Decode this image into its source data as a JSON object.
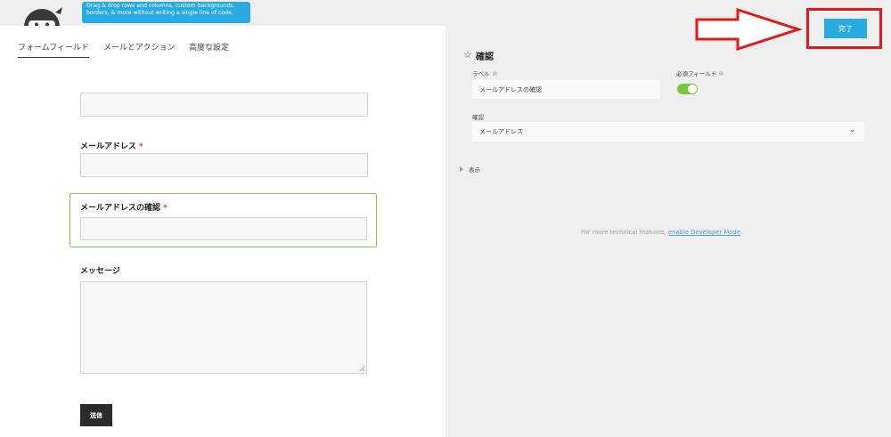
{
  "promo": {
    "lines": [
      "Drag & drop rows and columns, custom backgrounds,",
      "borders, & more without writing a single line of code."
    ]
  },
  "tabs": [
    {
      "label": "フォームフィールド",
      "active": true
    },
    {
      "label": "メールとアクション",
      "active": false
    },
    {
      "label": "高度な設定",
      "active": false
    }
  ],
  "form": {
    "fields": [
      {
        "label": "メールアドレス",
        "required": "*"
      },
      {
        "label": "メールアドレスの確認",
        "required": "*"
      },
      {
        "label": "メッセージ"
      }
    ],
    "submit_label": "送信"
  },
  "panel": {
    "title": "確認",
    "label_caption": "ラベル",
    "label_value": "メールアドレスの確認",
    "required_caption": "必須フィールド",
    "required_on": true,
    "confirm_caption": "確認",
    "confirm_value": "メールアドレス",
    "display_label": "表示",
    "dev_note_prefix": "For more technical features, ",
    "dev_note_link": "enable Developer Mode",
    "dev_note_suffix": "."
  },
  "done_label": "完了",
  "colors": {
    "accent": "#29aae1",
    "toggle_on": "#7cc63a",
    "selected_border": "#8bc34a",
    "annotation_red": "#e01919"
  }
}
